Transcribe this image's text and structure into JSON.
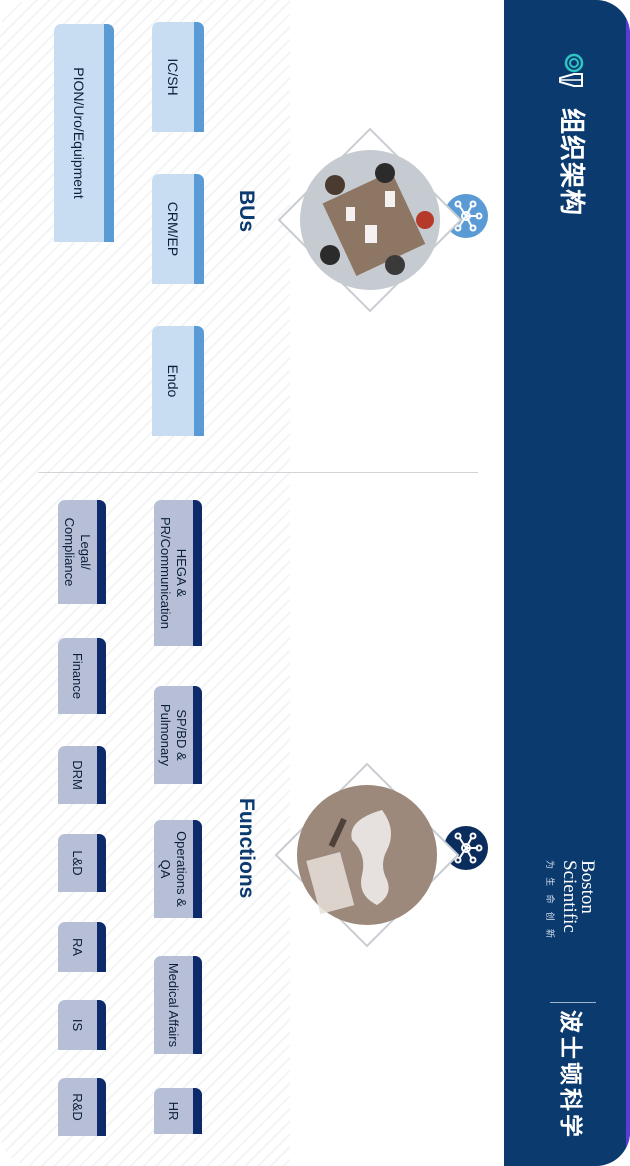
{
  "header": {
    "title": "组织架构",
    "brand_cn": "波士顿科学",
    "brand_en_line1": "Boston",
    "brand_en_line2": "Scientific",
    "brand_tagline": "为 生 命 创 新"
  },
  "bus": {
    "title": "BUs",
    "items": [
      {
        "label": "IC/SH"
      },
      {
        "label": "CRM/EP"
      },
      {
        "label": "Endo"
      },
      {
        "label": "PION/Uro/Equipment"
      }
    ]
  },
  "functions": {
    "title": "Functions",
    "items": [
      {
        "label": "HEGA & PR/Communication"
      },
      {
        "label": "SP/BD & Pulmonary"
      },
      {
        "label": "Operations & QA"
      },
      {
        "label": "Medical Affairs"
      },
      {
        "label": "HR"
      },
      {
        "label": "Legal/ Compliance"
      },
      {
        "label": "Finance"
      },
      {
        "label": "DRM"
      },
      {
        "label": "L&D"
      },
      {
        "label": "RA"
      },
      {
        "label": "IS"
      },
      {
        "label": "R&D"
      }
    ]
  },
  "icons": {
    "people": "people-group-icon",
    "network": "network-icon"
  },
  "colors": {
    "band": "#0b3a6e",
    "bu_accent": "#5b9bd5",
    "bu_tab": "#c9ddf2",
    "fn_accent": "#0d2a6b",
    "fn_tab": "#b7bfd6"
  }
}
